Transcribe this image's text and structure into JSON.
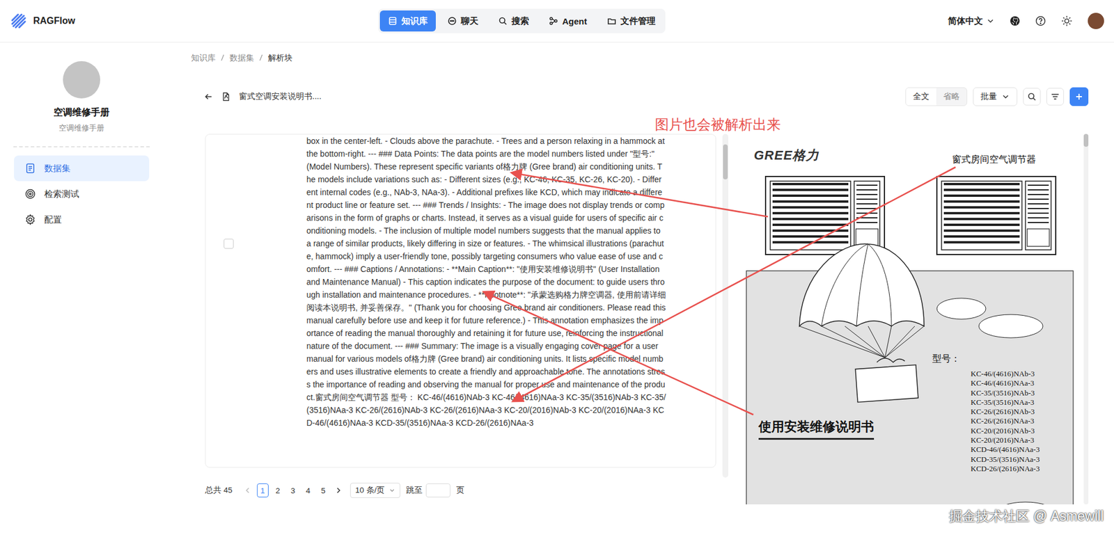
{
  "app": {
    "name": "RAGFlow"
  },
  "nav": {
    "tabs": [
      {
        "label": "知识库",
        "selected": true
      },
      {
        "label": "聊天",
        "selected": false
      },
      {
        "label": "搜索",
        "selected": false
      },
      {
        "label": "Agent",
        "selected": false
      },
      {
        "label": "文件管理",
        "selected": false
      }
    ],
    "language": "简体中文"
  },
  "sidebar": {
    "title": "空调维修手册",
    "subtitle": "空调维修手册",
    "items": [
      {
        "label": "数据集",
        "selected": true
      },
      {
        "label": "检索测试",
        "selected": false
      },
      {
        "label": "配置",
        "selected": false
      }
    ]
  },
  "breadcrumb": [
    "知识库",
    "数据集",
    "解析块"
  ],
  "toolbar": {
    "file_name": "窗式空调安装说明书....",
    "view_modes": [
      {
        "label": "全文",
        "selected": true
      },
      {
        "label": "省略",
        "selected": false
      }
    ],
    "batch": "批量"
  },
  "chunks": [
    {
      "checked": false,
      "text": "box in the center-left. - Clouds above the parachute. - Trees and a person relaxing in a hammock at the bottom-right. --- ### Data Points: The data points are the model numbers listed under \"型号:\" (Model Numbers). These represent specific variants of格力牌 (Gree brand) air conditioning units. The models include variations such as: - Different sizes (e.g., KC-46, KC-35, KC-26, KC-20). - Different internal codes (e.g., NAb-3, NAa-3). - Additional prefixes like KCD, which may indicate a different product line or feature set. --- ### Trends / Insights: - The image does not display trends or comparisons in the form of graphs or charts. Instead, it serves as a visual guide for users of specific air conditioning models. - The inclusion of multiple model numbers suggests that the manual applies to a range of similar products, likely differing in size or features. - The whimsical illustrations (parachute, hammock) imply a user-friendly tone, possibly targeting consumers who value ease of use and comfort. --- ### Captions / Annotations: - **Main Caption**: \"使用安装维修说明书\" (User Installation and Maintenance Manual) - This caption indicates the purpose of the document: to guide users through installation and maintenance procedures. - **Footnote**: \"承蒙选购格力牌空调器, 使用前请详细阅读本说明书, 并妥善保存。\" (Thank you for choosing Gree brand air conditioners. Please read this manual carefully before use and keep it for future reference.) - This annotation emphasizes the importance of reading the manual thoroughly and retaining it for future use, reinforcing the instructional nature of the document. --- ### Summary: The image is a visually engaging cover page for a user manual for various models of格力牌 (Gree brand) air conditioning units. It lists specific model numbers and uses illustrative elements to create a friendly and approachable tone. The annotations stress the importance of reading and observing the manual for proper use and maintenance of the product.窗式房间空气调节器 型号： KC-46/(4616)NAb-3 KC-46/(4616)NAa-3 KC-35/(3516)NAb-3 KC-35/(3516)NAa-3 KC-26/(2616)NAb-3 KC-26/(2616)NAa-3 KC-20/(2016)NAb-3 KC-20/(2016)NAa-3 KCD-46/(4616)NAa-3 KCD-35/(3516)NAa-3 KCD-26/(2616)NAa-3"
    }
  ],
  "preview": {
    "logo": "GREE格力",
    "product": "窗式房间空气调节器",
    "model_label": "型号：",
    "models": [
      "KC-46/(4616)NAb-3",
      "KC-46/(4616)NAa-3",
      "KC-35/(3516)NAb-3",
      "KC-35/(3516)NAa-3",
      "KC-26/(2616)NAb-3",
      "KC-26/(2616)NAa-3",
      "KC-20/(2016)NAb-3",
      "KC-20/(2016)NAa-3",
      "KCD-46/(4616)NAa-3",
      "KCD-35/(3516)NAa-3",
      "KCD-26/(2616)NAa-3"
    ],
    "title": "使用安装维修说明书"
  },
  "pagination": {
    "total_label": "总共 45",
    "prev": {
      "disabled": true
    },
    "next": {
      "disabled": false
    },
    "pages": [
      {
        "label": "1",
        "selected": true
      },
      {
        "label": "2",
        "selected": false
      },
      {
        "label": "3",
        "selected": false
      },
      {
        "label": "4",
        "selected": false
      },
      {
        "label": "5",
        "selected": false
      }
    ],
    "page_size": "10 条/页",
    "jump_label": "跳至",
    "page_suffix": "页"
  },
  "annotation": {
    "text": "图片也会被解析出来"
  },
  "watermark": "掘金技术社区 @ Asmewill"
}
